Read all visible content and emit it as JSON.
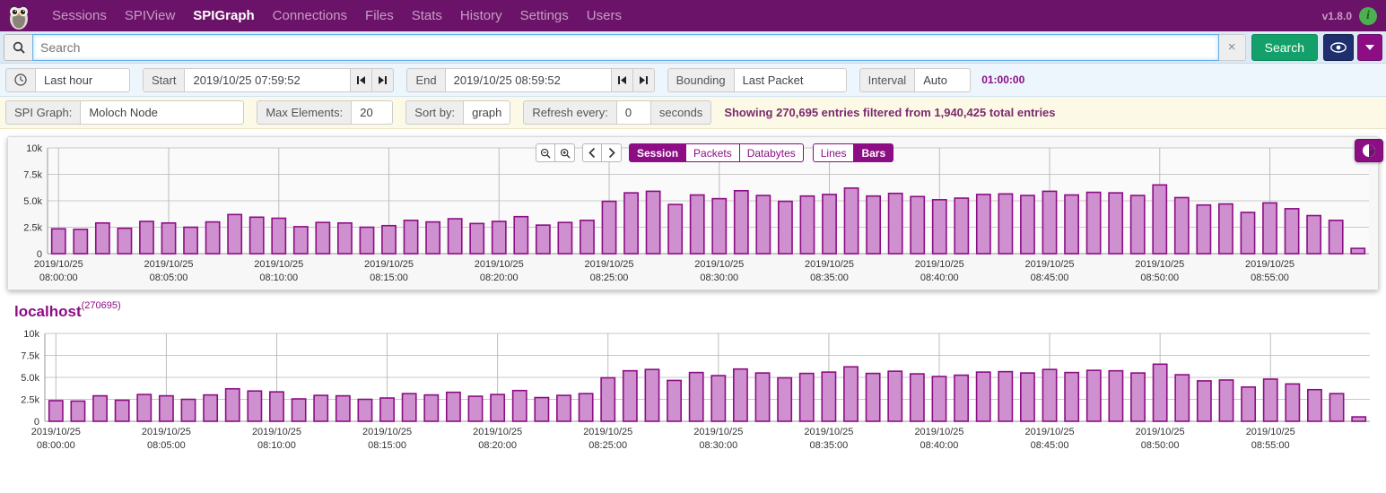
{
  "navbar": {
    "logo": "owl-logo",
    "links": [
      {
        "label": "Sessions",
        "active": false
      },
      {
        "label": "SPIView",
        "active": false
      },
      {
        "label": "SPIGraph",
        "active": true
      },
      {
        "label": "Connections",
        "active": false
      },
      {
        "label": "Files",
        "active": false
      },
      {
        "label": "Stats",
        "active": false
      },
      {
        "label": "History",
        "active": false
      },
      {
        "label": "Settings",
        "active": false
      },
      {
        "label": "Users",
        "active": false
      }
    ],
    "version": "v1.8.0",
    "info_icon": "info-circle-icon"
  },
  "search": {
    "icon": "search-icon",
    "placeholder": "Search",
    "value": "",
    "clear_label": "×",
    "search_button": "Search",
    "eye_icon": "eye-icon",
    "caret_icon": "caret-down-icon"
  },
  "timebar": {
    "clock_icon": "clock-icon",
    "range_value": "Last hour",
    "start_label": "Start",
    "start_value": "2019/10/25 07:59:52",
    "end_label": "End",
    "end_value": "2019/10/25 08:59:52",
    "step_back_icon": "step-backward-icon",
    "step_fwd_icon": "step-forward-icon",
    "bounding_label": "Bounding",
    "bounding_value": "Last Packet",
    "interval_label": "Interval",
    "interval_value": "Auto",
    "duration": "01:00:00"
  },
  "spibar": {
    "spigraph_label": "SPI Graph:",
    "spigraph_value": "Moloch Node",
    "max_elements_label": "Max Elements:",
    "max_elements_value": "20",
    "sort_by_label": "Sort by:",
    "sort_by_value": "graph",
    "refresh_label": "Refresh every:",
    "refresh_value": "0",
    "seconds_label": "seconds",
    "showing": "Showing 270,695 entries filtered from 1,940,425 total entries"
  },
  "chart_toolbar": {
    "zoom_out_icon": "zoom-out-icon",
    "zoom_in_icon": "zoom-in-icon",
    "prev_icon": "chevron-left-icon",
    "next_icon": "chevron-right-icon",
    "metrics": [
      {
        "label": "Session",
        "active": true
      },
      {
        "label": "Packets",
        "active": false
      },
      {
        "label": "Databytes",
        "active": false
      }
    ],
    "styles": [
      {
        "label": "Lines",
        "active": false
      },
      {
        "label": "Bars",
        "active": true
      }
    ],
    "pie_icon": "pie-chart-icon"
  },
  "bottom": {
    "host_name": "localhost",
    "host_count": "(270695)"
  },
  "colors": {
    "brand_purple": "#6b1368",
    "accent_purple": "#8c0d84",
    "bar_fill": "#cf90d0",
    "bar_stroke": "#8c0d84",
    "search_green": "#14a06a",
    "eye_blue": "#1f2f6e",
    "info_green": "#4caf50"
  },
  "chart_data": {
    "type": "bar",
    "title": "",
    "xlabel": "",
    "ylabel": "",
    "ylim": [
      0,
      10000
    ],
    "ytick_labels": [
      "10k",
      "7.5k",
      "5.0k",
      "2.5k",
      "0"
    ],
    "ytick_values": [
      10000,
      7500,
      5000,
      2500,
      0
    ],
    "grid": true,
    "legend": "none",
    "xtick_labels": [
      "2019/10/25 08:00:00",
      "2019/10/25 08:05:00",
      "2019/10/25 08:10:00",
      "2019/10/25 08:15:00",
      "2019/10/25 08:20:00",
      "2019/10/25 08:25:00",
      "2019/10/25 08:30:00",
      "2019/10/25 08:35:00",
      "2019/10/25 08:40:00",
      "2019/10/25 08:45:00",
      "2019/10/25 08:50:00",
      "2019/10/25 08:55:00"
    ],
    "xtick_values": [
      0,
      5,
      10,
      15,
      20,
      25,
      30,
      35,
      40,
      45,
      50,
      55
    ],
    "categories": [
      "08:00",
      "08:01",
      "08:02",
      "08:03",
      "08:04",
      "08:05",
      "08:06",
      "08:07",
      "08:08",
      "08:09",
      "08:10",
      "08:11",
      "08:12",
      "08:13",
      "08:14",
      "08:15",
      "08:16",
      "08:17",
      "08:18",
      "08:19",
      "08:20",
      "08:21",
      "08:22",
      "08:23",
      "08:24",
      "08:25",
      "08:26",
      "08:27",
      "08:28",
      "08:29",
      "08:30",
      "08:31",
      "08:32",
      "08:33",
      "08:34",
      "08:35",
      "08:36",
      "08:37",
      "08:38",
      "08:39",
      "08:40",
      "08:41",
      "08:42",
      "08:43",
      "08:44",
      "08:45",
      "08:46",
      "08:47",
      "08:48",
      "08:49",
      "08:50",
      "08:51",
      "08:52",
      "08:53",
      "08:54",
      "08:55",
      "08:56",
      "08:57",
      "08:58",
      "08:59"
    ],
    "values": [
      2350,
      2300,
      2900,
      2400,
      3050,
      2900,
      2500,
      3000,
      3700,
      3450,
      3350,
      2550,
      2950,
      2900,
      2500,
      2650,
      3150,
      3000,
      3300,
      2850,
      3050,
      3500,
      2700,
      2950,
      3150,
      4950,
      5750,
      5900,
      4650,
      5550,
      5200,
      5950,
      5500,
      4950,
      5450,
      5600,
      6200,
      5450,
      5700,
      5400,
      5100,
      5250,
      5600,
      5650,
      5500,
      5900,
      5550,
      5800,
      5750,
      5500,
      6500,
      5300,
      4600,
      4700,
      3900,
      4800,
      4250,
      3600,
      3150,
      500
    ],
    "series": [
      {
        "name": "Session",
        "values": [
          2350,
          2300,
          2900,
          2400,
          3050,
          2900,
          2500,
          3000,
          3700,
          3450,
          3350,
          2550,
          2950,
          2900,
          2500,
          2650,
          3150,
          3000,
          3300,
          2850,
          3050,
          3500,
          2700,
          2950,
          3150,
          4950,
          5750,
          5900,
          4650,
          5550,
          5200,
          5950,
          5500,
          4950,
          5450,
          5600,
          6200,
          5450,
          5700,
          5400,
          5100,
          5250,
          5600,
          5650,
          5500,
          5900,
          5550,
          5800,
          5750,
          5500,
          6500,
          5300,
          4600,
          4700,
          3900,
          4800,
          4250,
          3600,
          3150,
          500
        ]
      }
    ]
  }
}
